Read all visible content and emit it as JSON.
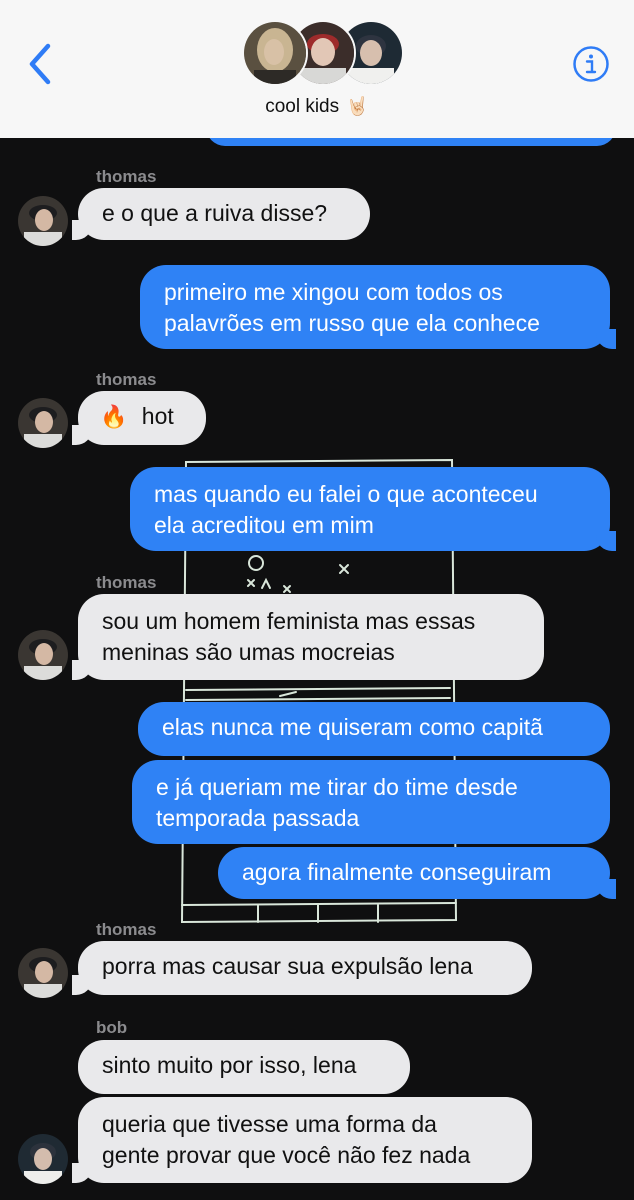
{
  "header": {
    "title": "cool kids",
    "title_emoji": "🤘🏻"
  },
  "messages": [
    {
      "type": "sender",
      "text": "thomas"
    },
    {
      "type": "in",
      "text": "e o que a ruiva disse?"
    },
    {
      "type": "out",
      "lines": [
        "primeiro me xingou com todos os",
        "palavrões em russo que ela conhece"
      ]
    },
    {
      "type": "sender",
      "text": "thomas"
    },
    {
      "type": "in",
      "emoji": "🔥",
      "text": "hot"
    },
    {
      "type": "out",
      "lines": [
        "mas quando eu falei o que aconteceu",
        "ela acreditou em mim"
      ]
    },
    {
      "type": "sender",
      "text": "thomas"
    },
    {
      "type": "in",
      "lines": [
        "sou um homem feminista mas essas",
        "meninas são umas mocreias"
      ]
    },
    {
      "type": "out",
      "text": "elas nunca me quiseram como capitã"
    },
    {
      "type": "out",
      "lines": [
        "e já queriam me tirar do time desde",
        "temporada passada"
      ]
    },
    {
      "type": "out",
      "text": "agora finalmente conseguiram"
    },
    {
      "type": "sender",
      "text": "thomas"
    },
    {
      "type": "in",
      "text": "porra mas causar sua expulsão lena"
    },
    {
      "type": "sender",
      "text": "bob"
    },
    {
      "type": "in",
      "text": "sinto muito por isso, lena"
    },
    {
      "type": "in",
      "lines": [
        "queria que tivesse uma forma da",
        "gente provar que você não fez nada"
      ]
    }
  ]
}
